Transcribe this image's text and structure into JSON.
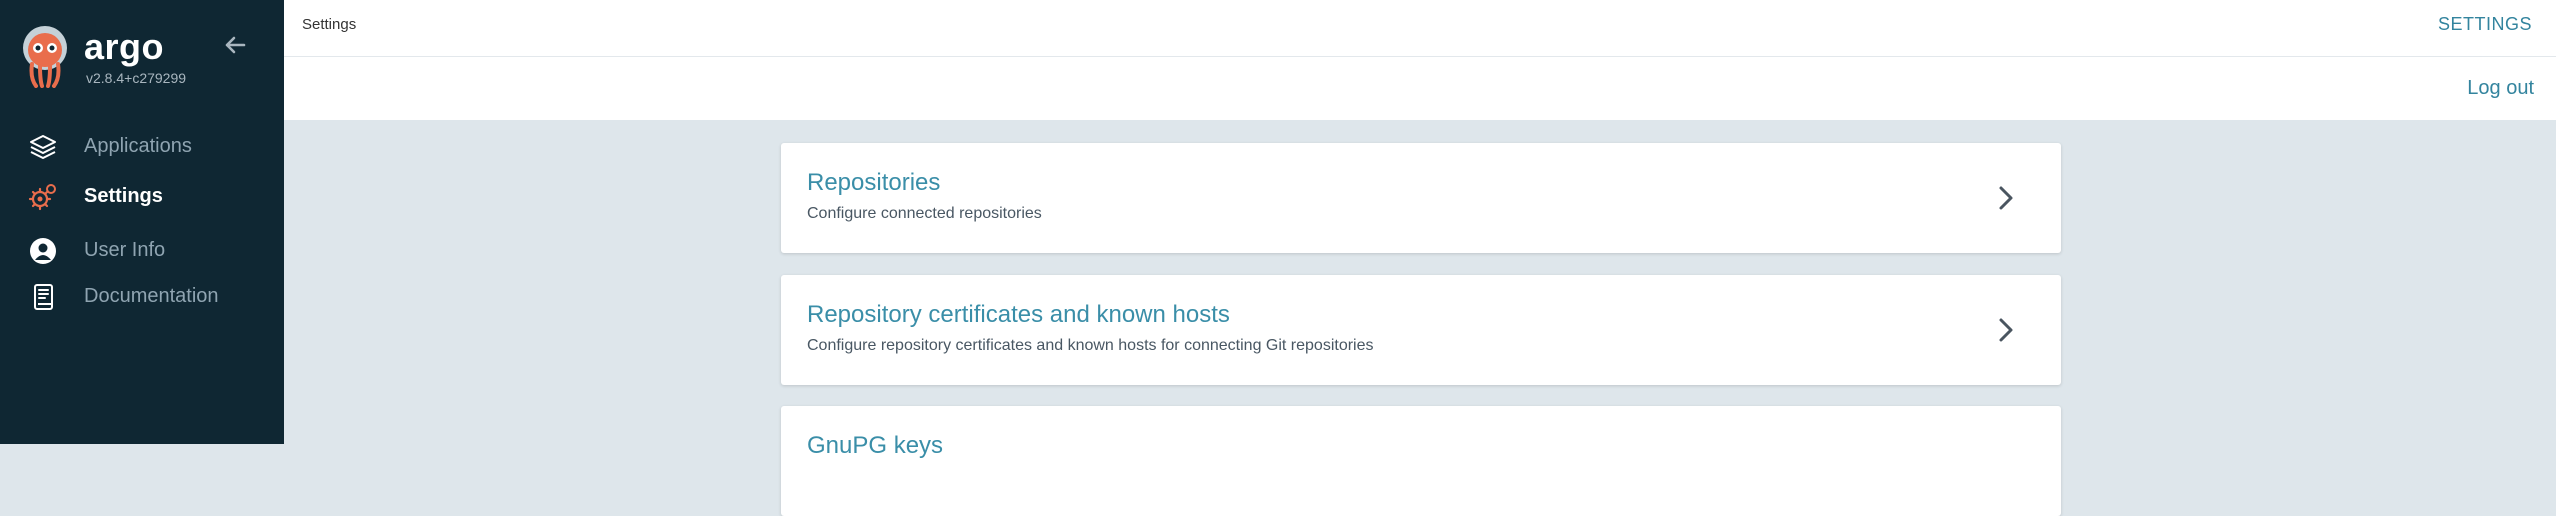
{
  "app": {
    "brand": "argo",
    "version": "v2.8.4+c279299"
  },
  "sidebar": {
    "items": [
      {
        "label": "Applications",
        "icon": "layers-icon",
        "active": false
      },
      {
        "label": "Settings",
        "icon": "gears-icon",
        "active": true
      },
      {
        "label": "User Info",
        "icon": "user-circle-icon",
        "active": false
      },
      {
        "label": "Documentation",
        "icon": "book-icon",
        "active": false
      }
    ]
  },
  "header": {
    "breadcrumb": "Settings",
    "title": "SETTINGS",
    "logout_label": "Log out"
  },
  "cards": [
    {
      "title": "Repositories",
      "description": "Configure connected repositories"
    },
    {
      "title": "Repository certificates and known hosts",
      "description": "Configure repository certificates and known hosts for connecting Git repositories"
    },
    {
      "title": "GnuPG keys",
      "description": ""
    }
  ],
  "colors": {
    "sidebar_bg": "#0f2733",
    "accent": "#33849e",
    "active_icon": "#e96d4c",
    "page_bg": "#dee6eb"
  }
}
